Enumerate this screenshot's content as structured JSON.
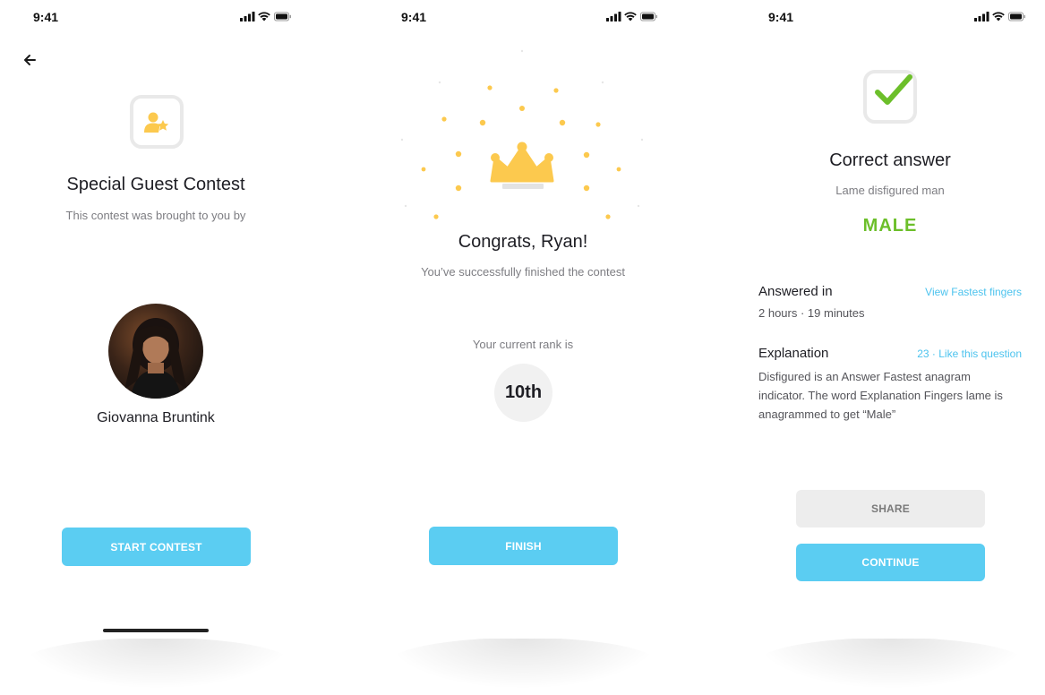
{
  "status_bar": {
    "time": "9:41"
  },
  "screen1": {
    "title": "Special Guest Contest",
    "subtitle": "This contest was brought to you by",
    "guest_name": "Giovanna Bruntink",
    "start_button": "START CONTEST"
  },
  "screen2": {
    "title": "Congrats, Ryan!",
    "subtitle": "You’ve successfully finished the contest",
    "rank_label": "Your current rank is",
    "rank_value": "10th",
    "finish_button": "FINISH"
  },
  "screen3": {
    "title": "Correct answer",
    "clue": "Lame disfigured man",
    "answer": "MALE",
    "answered_in_label": "Answered in",
    "answered_in_value": "2 hours · 19 minutes",
    "view_fastest_link": "View Fastest fingers",
    "explanation_label": "Explanation",
    "like_link": "23 · Like this question",
    "explanation_text": "Disfigured is an Answer Fastest anagram indicator. The word Explanation Fingers lame is anagrammed to get “Male”",
    "share_button": "SHARE",
    "continue_button": "CONTINUE"
  },
  "colors": {
    "accent": "#5bcdf2",
    "link": "#4cc3ee",
    "gold": "#fcc94e",
    "correct_green": "#6cbf2a",
    "muted_text": "#7d7d82"
  },
  "icons": [
    "back-arrow-icon",
    "user-star-icon",
    "crown-icon",
    "checkmark-icon",
    "signal-icon",
    "wifi-icon",
    "battery-icon"
  ]
}
